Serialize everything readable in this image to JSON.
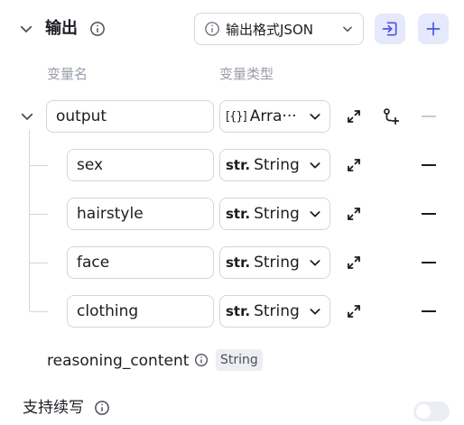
{
  "header": {
    "title": "输出",
    "format_select": {
      "value": "输出格式JSON",
      "icon": "info-icon"
    },
    "import_button_icon": "import-icon",
    "add_button_icon": "plus-icon"
  },
  "columns": {
    "name": "变量名",
    "type": "变量类型"
  },
  "root": {
    "name": "output",
    "type_icon": "[{}]",
    "type_label": "Arra···"
  },
  "children": [
    {
      "name": "sex",
      "type_icon": "str.",
      "type_label": "String"
    },
    {
      "name": "hairstyle",
      "type_icon": "str.",
      "type_label": "String"
    },
    {
      "name": "face",
      "type_icon": "str.",
      "type_label": "String"
    },
    {
      "name": "clothing",
      "type_icon": "str.",
      "type_label": "String"
    }
  ],
  "reasoning": {
    "name": "reasoning_content",
    "badge": "String"
  },
  "continue_writing": {
    "label": "支持续写",
    "enabled": false
  },
  "colors": {
    "accent": "#4d53e8",
    "accent_bg": "#e6e8fc",
    "border": "#d4d6de",
    "muted": "#9a9dab"
  }
}
